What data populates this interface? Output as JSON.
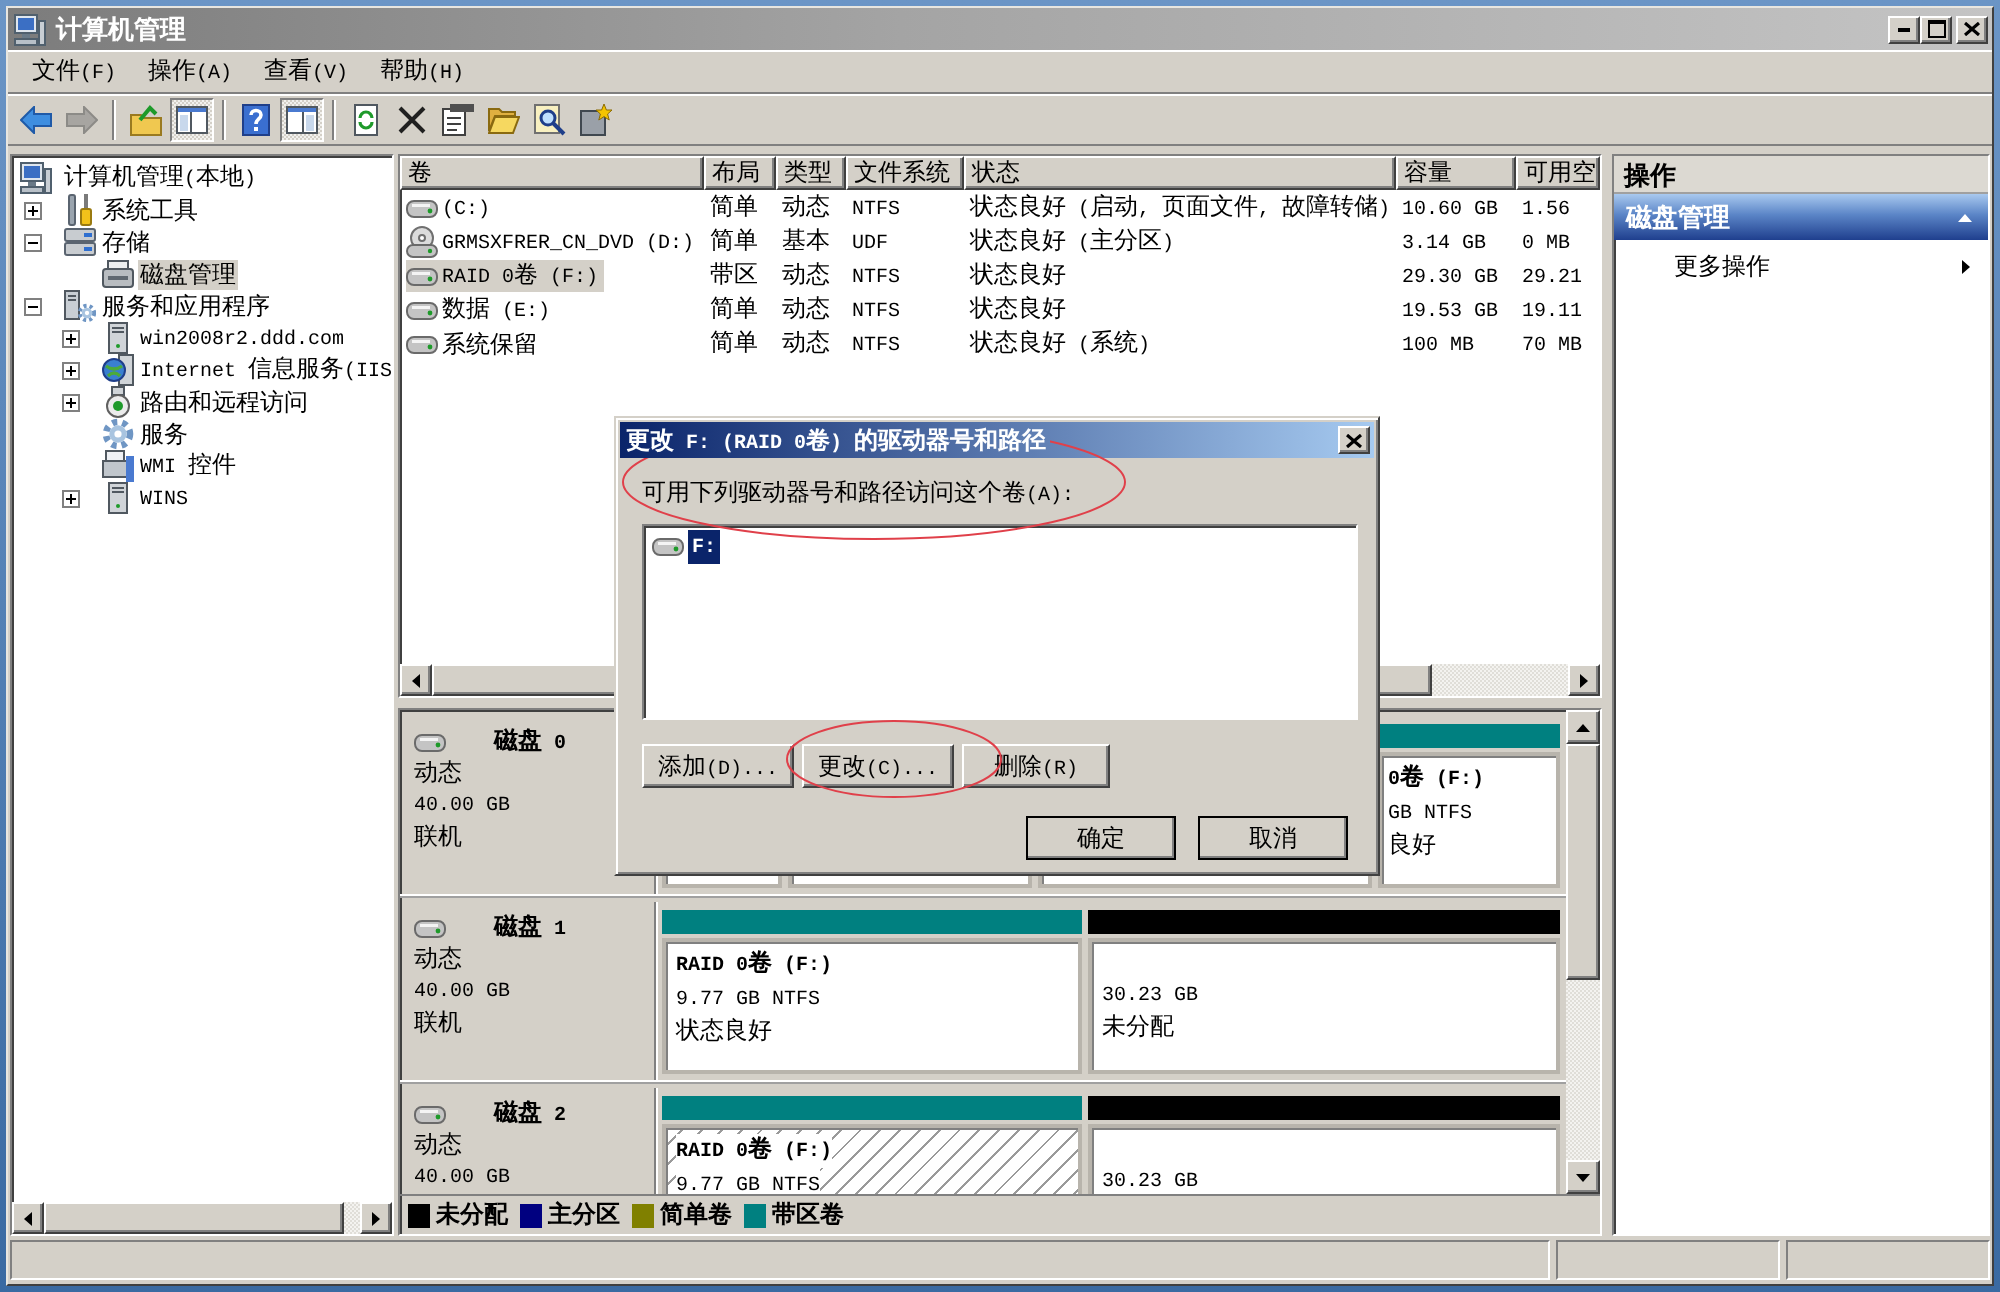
{
  "window": {
    "title": "计算机管理"
  },
  "menu": [
    "文件(F)",
    "操作(A)",
    "查看(V)",
    "帮助(H)"
  ],
  "toolbar": [
    {
      "kind": "back",
      "pressed": false,
      "disabled": false
    },
    {
      "kind": "forward",
      "pressed": false,
      "disabled": true
    },
    {
      "kind": "separator"
    },
    {
      "kind": "up",
      "pressed": false,
      "disabled": false
    },
    {
      "kind": "tree",
      "pressed": true,
      "disabled": false
    },
    {
      "kind": "separator"
    },
    {
      "kind": "help",
      "pressed": false,
      "disabled": false
    },
    {
      "kind": "pane",
      "pressed": true,
      "disabled": false
    },
    {
      "kind": "separator"
    },
    {
      "kind": "refresh",
      "pressed": false,
      "disabled": false
    },
    {
      "kind": "delete",
      "pressed": false,
      "disabled": false
    },
    {
      "kind": "properties",
      "pressed": false,
      "disabled": false
    },
    {
      "kind": "open",
      "pressed": false,
      "disabled": false
    },
    {
      "kind": "search",
      "pressed": false,
      "disabled": false
    },
    {
      "kind": "disk-tool",
      "pressed": false,
      "disabled": false
    }
  ],
  "tree": [
    {
      "label": "计算机管理(本地)",
      "kind": "computer",
      "selected": false,
      "children": [
        {
          "label": "系统工具",
          "kind": "tools",
          "expanded": false,
          "selected": false
        },
        {
          "label": "存储",
          "kind": "storage",
          "expanded": true,
          "selected": false,
          "children": [
            {
              "label": "磁盘管理",
              "kind": "disk-management",
              "selected": true
            }
          ]
        },
        {
          "label": "服务和应用程序",
          "kind": "services",
          "expanded": true,
          "selected": false,
          "children": [
            {
              "label": "win2008r2.ddd.com",
              "kind": "server",
              "expanded": false,
              "selected": false
            },
            {
              "label": "Internet 信息服务(IIS",
              "kind": "iis",
              "expanded": false,
              "selected": false
            },
            {
              "label": "路由和远程访问",
              "kind": "routing",
              "expanded": false,
              "selected": false
            },
            {
              "label": "服务",
              "kind": "service",
              "selected": false
            },
            {
              "label": "WMI 控件",
              "kind": "wmi",
              "selected": false
            },
            {
              "label": "WINS",
              "kind": "wins",
              "expanded": false,
              "selected": false
            }
          ]
        }
      ]
    }
  ],
  "volumes": {
    "columns": [
      "卷",
      "布局",
      "类型",
      "文件系统",
      "状态",
      "容量",
      "可用空"
    ],
    "rows": [
      {
        "kind": "disk",
        "selected": false,
        "cells": [
          "(C:)",
          "简单",
          "动态",
          "NTFS",
          "状态良好 (启动, 页面文件, 故障转储)",
          "10.60 GB",
          "1.56"
        ]
      },
      {
        "kind": "dvd",
        "selected": false,
        "cells": [
          "GRMSXFRER_CN_DVD (D:)",
          "简单",
          "基本",
          "UDF",
          "状态良好 (主分区)",
          "3.14 GB",
          "0 MB"
        ]
      },
      {
        "kind": "disk",
        "selected": true,
        "cells": [
          "RAID 0卷 (F:)",
          "带区",
          "动态",
          "NTFS",
          "状态良好",
          "29.30 GB",
          "29.21"
        ]
      },
      {
        "kind": "disk",
        "selected": false,
        "cells": [
          "数据 (E:)",
          "简单",
          "动态",
          "NTFS",
          "状态良好",
          "19.53 GB",
          "19.11"
        ]
      },
      {
        "kind": "disk",
        "selected": false,
        "cells": [
          "系统保留",
          "简单",
          "动态",
          "NTFS",
          "状态良好 (系统)",
          "100 MB",
          "70 MB"
        ]
      }
    ]
  },
  "disks": [
    {
      "name": "磁盘 0",
      "lines": [
        "动态",
        "40.00 GB",
        "联机"
      ],
      "partitions": [
        {
          "selected": false
        },
        {
          "selected": false
        },
        {
          "selected": false
        },
        {
          "kind": "striped",
          "selected": false,
          "title": "0卷 (F:)",
          "lines": [
            "GB NTFS",
            "良好"
          ]
        }
      ]
    },
    {
      "name": "磁盘 1",
      "lines": [
        "动态",
        "40.00 GB",
        "联机"
      ],
      "partitions": [
        {
          "kind": "striped",
          "selected": false,
          "title": "RAID 0卷 (F:)",
          "lines": [
            "9.77 GB NTFS",
            "状态良好"
          ]
        },
        {
          "kind": "unallocated",
          "selected": false,
          "lines": [
            "30.23 GB",
            "未分配"
          ]
        }
      ]
    },
    {
      "name": "磁盘 2",
      "lines": [
        "动态",
        "40.00 GB"
      ],
      "partitions": [
        {
          "kind": "striped",
          "selected": true,
          "title": "RAID 0卷 (F:)",
          "lines": [
            "9.77 GB NTFS"
          ]
        },
        {
          "kind": "unallocated",
          "selected": false,
          "lines": [
            "30.23 GB"
          ]
        }
      ]
    }
  ],
  "legend": [
    {
      "label": "未分配",
      "color": "#000000"
    },
    {
      "label": "主分区",
      "color": "#000080"
    },
    {
      "label": "简单卷",
      "color": "#808000"
    },
    {
      "label": "带区卷",
      "color": "#008080"
    }
  ],
  "actions": {
    "title": "操作",
    "section": {
      "title": "磁盘管理",
      "expanded": true
    },
    "items": [
      {
        "label": "更多操作",
        "submenu": true
      }
    ]
  },
  "dialog": {
    "title": "更改 F: (RAID 0卷) 的驱动器号和路径",
    "prompt": "可用下列驱动器号和路径访问这个卷(A):",
    "entries": [
      {
        "label": "F:",
        "selected": true
      }
    ],
    "buttons": [
      "添加(D)...",
      "更改(C)...",
      "删除(R)"
    ],
    "footer_buttons": [
      "确定",
      "取消"
    ]
  }
}
